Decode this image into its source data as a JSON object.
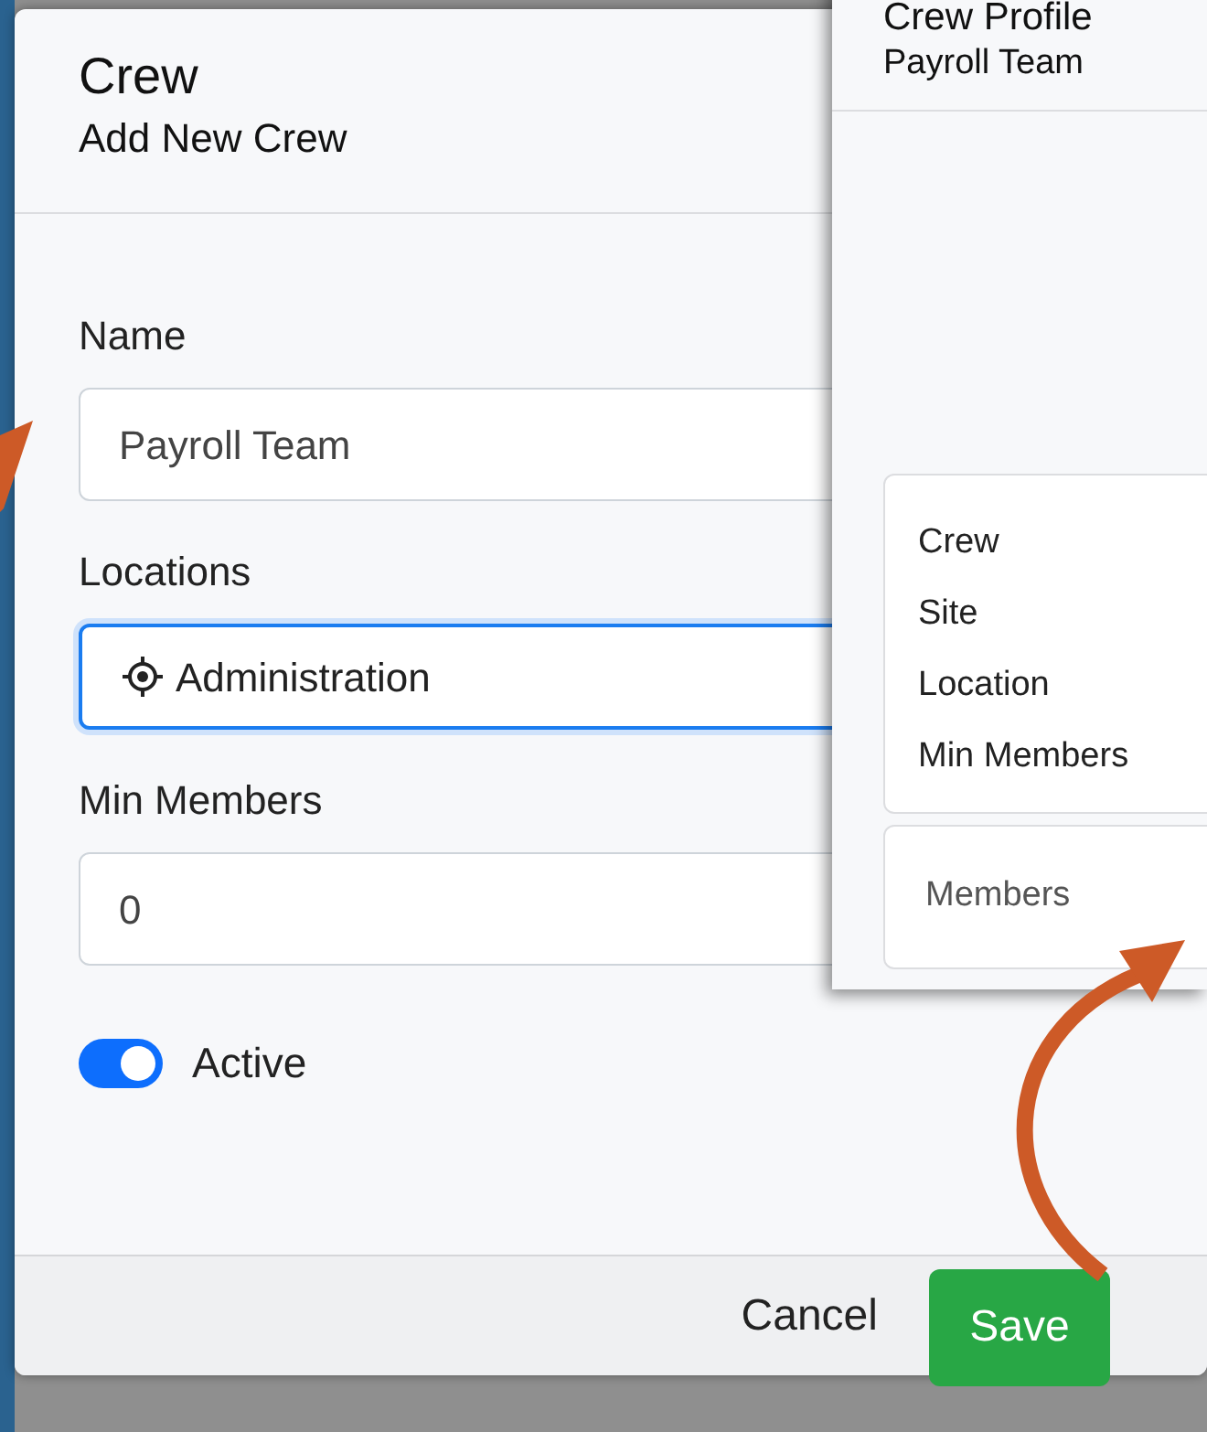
{
  "modal": {
    "title": "Crew",
    "subtitle": "Add New Crew",
    "fields": [
      {
        "kind": "text",
        "label": "Name",
        "value": "Payroll Team",
        "focused": false
      },
      {
        "kind": "select",
        "label": "Locations",
        "value": "Administration",
        "focused": true
      },
      {
        "kind": "number",
        "label": "Min Members",
        "value": "0",
        "focused": false
      }
    ],
    "switch": {
      "label": "Active",
      "on": true
    },
    "buttons": [
      {
        "kind": "link",
        "label": "Cancel"
      },
      {
        "kind": "primary",
        "label": "Save"
      }
    ]
  },
  "profile": {
    "title": "Crew Profile",
    "subtitle": "Payroll Team",
    "details": [
      "Crew",
      "Site",
      "Location",
      "Min Members"
    ],
    "members": "Members"
  }
}
